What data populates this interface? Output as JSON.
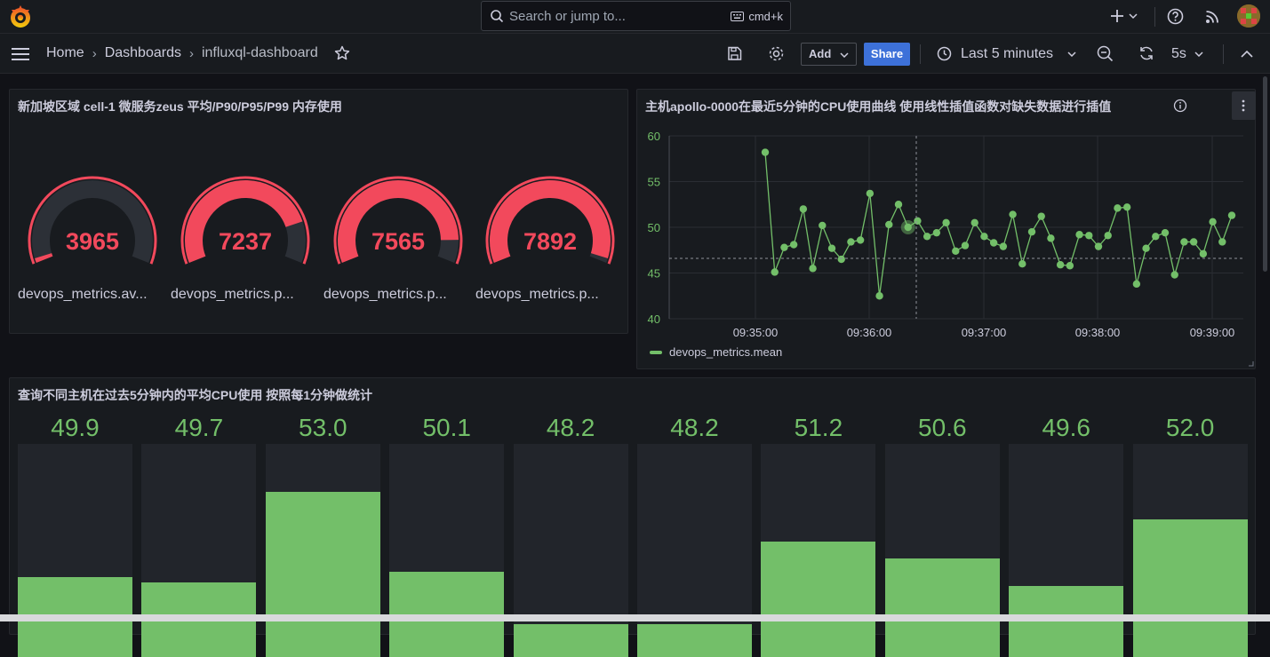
{
  "topbar": {
    "search_placeholder": "Search or jump to...",
    "search_shortcut": "cmd+k"
  },
  "navbar": {
    "breadcrumbs": [
      "Home",
      "Dashboards",
      "influxql-dashboard"
    ],
    "add_label": "Add",
    "share_label": "Share",
    "time_range": "Last 5 minutes",
    "refresh_interval": "5s"
  },
  "panels": {
    "gauges": {
      "title": "新加坡区域 cell-1 微服务zeus 平均/P90/P95/P99 内存使用",
      "items": [
        {
          "value": "3965",
          "label": "devops_metrics.av..."
        },
        {
          "value": "7237",
          "label": "devops_metrics.p..."
        },
        {
          "value": "7565",
          "label": "devops_metrics.p..."
        },
        {
          "value": "7892",
          "label": "devops_metrics.p..."
        }
      ],
      "accent": "#f2495c"
    },
    "timeseries": {
      "title": "主机apollo-0000在最近5分钟的CPU使用曲线 使用线性插值函数对缺失数据进行插值",
      "legend": "devops_metrics.mean"
    },
    "bars": {
      "title": "查询不同主机在过去5分钟内的平均CPU使用 按照每1分钟做统计"
    }
  },
  "chart_data": [
    {
      "type": "line",
      "series_color": "#73bf69",
      "yticks": [
        "40",
        "45",
        "50",
        "55",
        "60"
      ],
      "ylim": [
        40,
        60
      ],
      "xticks": [
        "09:35:00",
        "09:36:00",
        "09:37:00",
        "09:38:00",
        "09:39:00"
      ],
      "series": [
        {
          "name": "devops_metrics.mean",
          "values": [
            58.2,
            45.1,
            47.8,
            48.1,
            52.0,
            45.5,
            50.2,
            47.7,
            46.5,
            48.4,
            48.6,
            53.7,
            42.5,
            50.3,
            52.5,
            50.0,
            50.7,
            49.0,
            49.4,
            50.5,
            47.4,
            48.0,
            50.5,
            49.0,
            48.3,
            47.9,
            51.4,
            46.0,
            49.5,
            51.2,
            48.8,
            45.9,
            45.8,
            49.2,
            49.1,
            47.9,
            49.1,
            52.1,
            52.2,
            43.8,
            47.7,
            49.0,
            49.4,
            44.8,
            48.4,
            48.4,
            47.1,
            50.6,
            48.4,
            51.3
          ]
        }
      ]
    },
    {
      "type": "bar",
      "values": [
        49.9,
        49.7,
        53.0,
        50.1,
        48.2,
        48.2,
        51.2,
        50.6,
        49.6,
        52.0
      ],
      "labels": [
        "49.9",
        "49.7",
        "53.0",
        "50.1",
        "48.2",
        "48.2",
        "51.2",
        "50.6",
        "49.6",
        "52.0"
      ],
      "ylim": [
        47,
        54.5
      ],
      "color": "#73bf69"
    }
  ]
}
